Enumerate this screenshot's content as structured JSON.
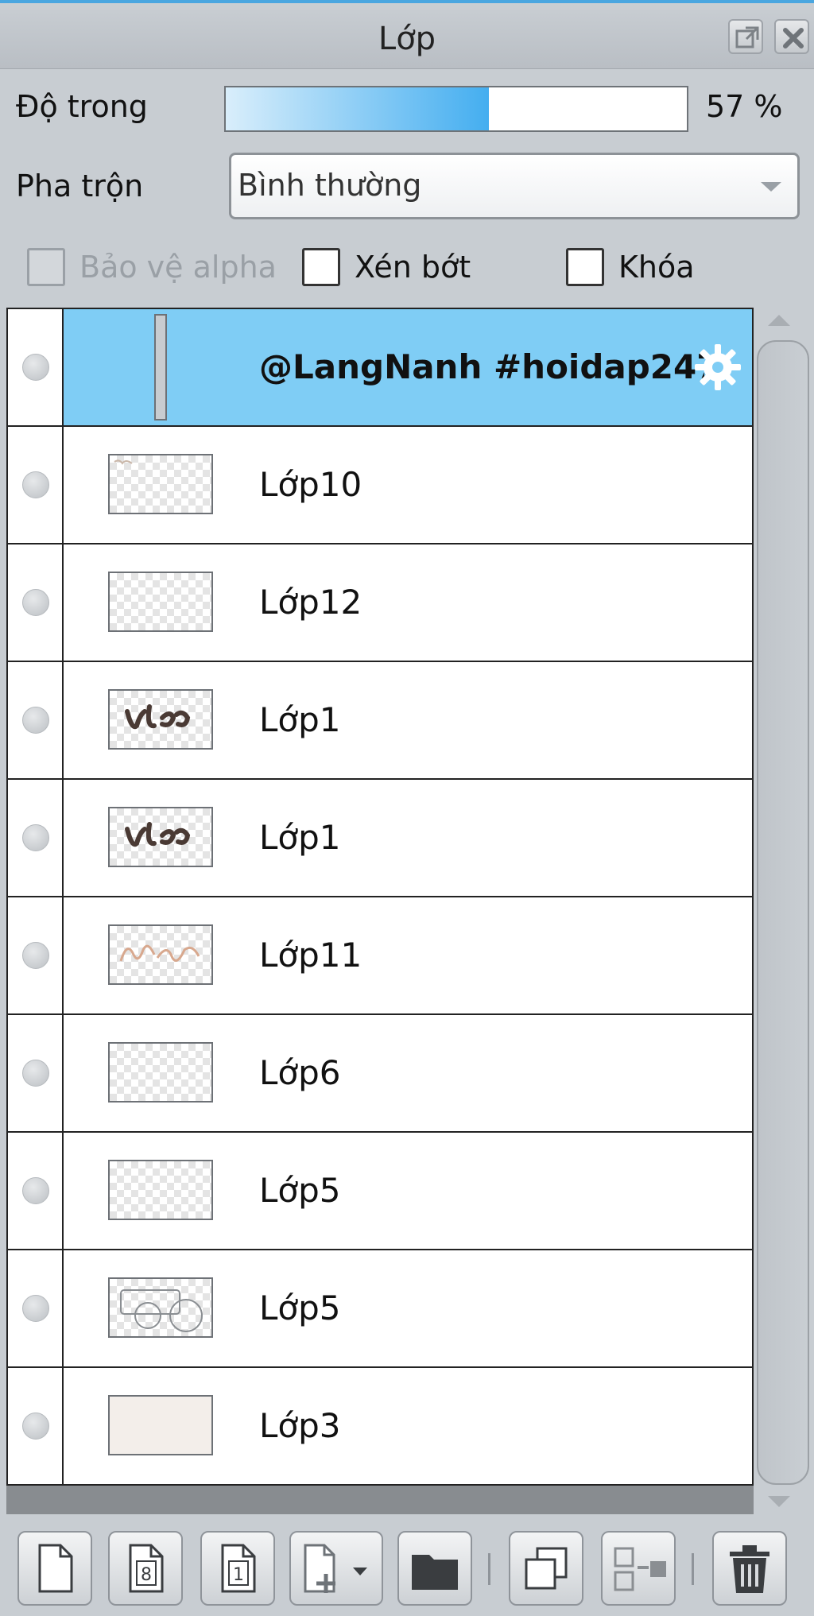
{
  "panel": {
    "title": "Lớp",
    "float_icon": "popout-icon",
    "close_icon": "close-icon"
  },
  "opacity": {
    "label": "Độ trong",
    "percent": 57,
    "value_text": "57 %"
  },
  "blend": {
    "label": "Pha trộn",
    "value": "Bình thường"
  },
  "options": {
    "alpha_protect": {
      "label": "Bảo vệ alpha",
      "checked": false,
      "disabled": true
    },
    "clip": {
      "label": "Xén bớt",
      "checked": false
    },
    "lock": {
      "label": "Khóa",
      "checked": false
    }
  },
  "layers": [
    {
      "name": "@LangNanh #hoidap247",
      "selected": true,
      "thumb": "tall-strip"
    },
    {
      "name": "Lớp10",
      "thumb": "transparent-sketch"
    },
    {
      "name": "Lớp12",
      "thumb": "transparent"
    },
    {
      "name": "Lớp1",
      "thumb": "lettering-dark"
    },
    {
      "name": "Lớp1",
      "thumb": "lettering-dark"
    },
    {
      "name": "Lớp11",
      "thumb": "lettering-outline"
    },
    {
      "name": "Lớp6",
      "thumb": "transparent"
    },
    {
      "name": "Lớp5",
      "thumb": "transparent"
    },
    {
      "name": "Lớp5",
      "thumb": "shapes-outline"
    },
    {
      "name": "Lớp3",
      "thumb": "solid-fill"
    }
  ],
  "toolbar": {
    "buttons": [
      "new-layer-icon",
      "new-8bit-layer-icon",
      "new-1bit-layer-icon",
      "add-layer-menu-icon",
      "new-folder-icon",
      "duplicate-layer-icon",
      "merge-down-icon",
      "delete-layer-icon"
    ]
  },
  "colors": {
    "selection": "#7fcdf5",
    "accent": "#44aef0",
    "panel_bg": "#c8cdd2"
  }
}
